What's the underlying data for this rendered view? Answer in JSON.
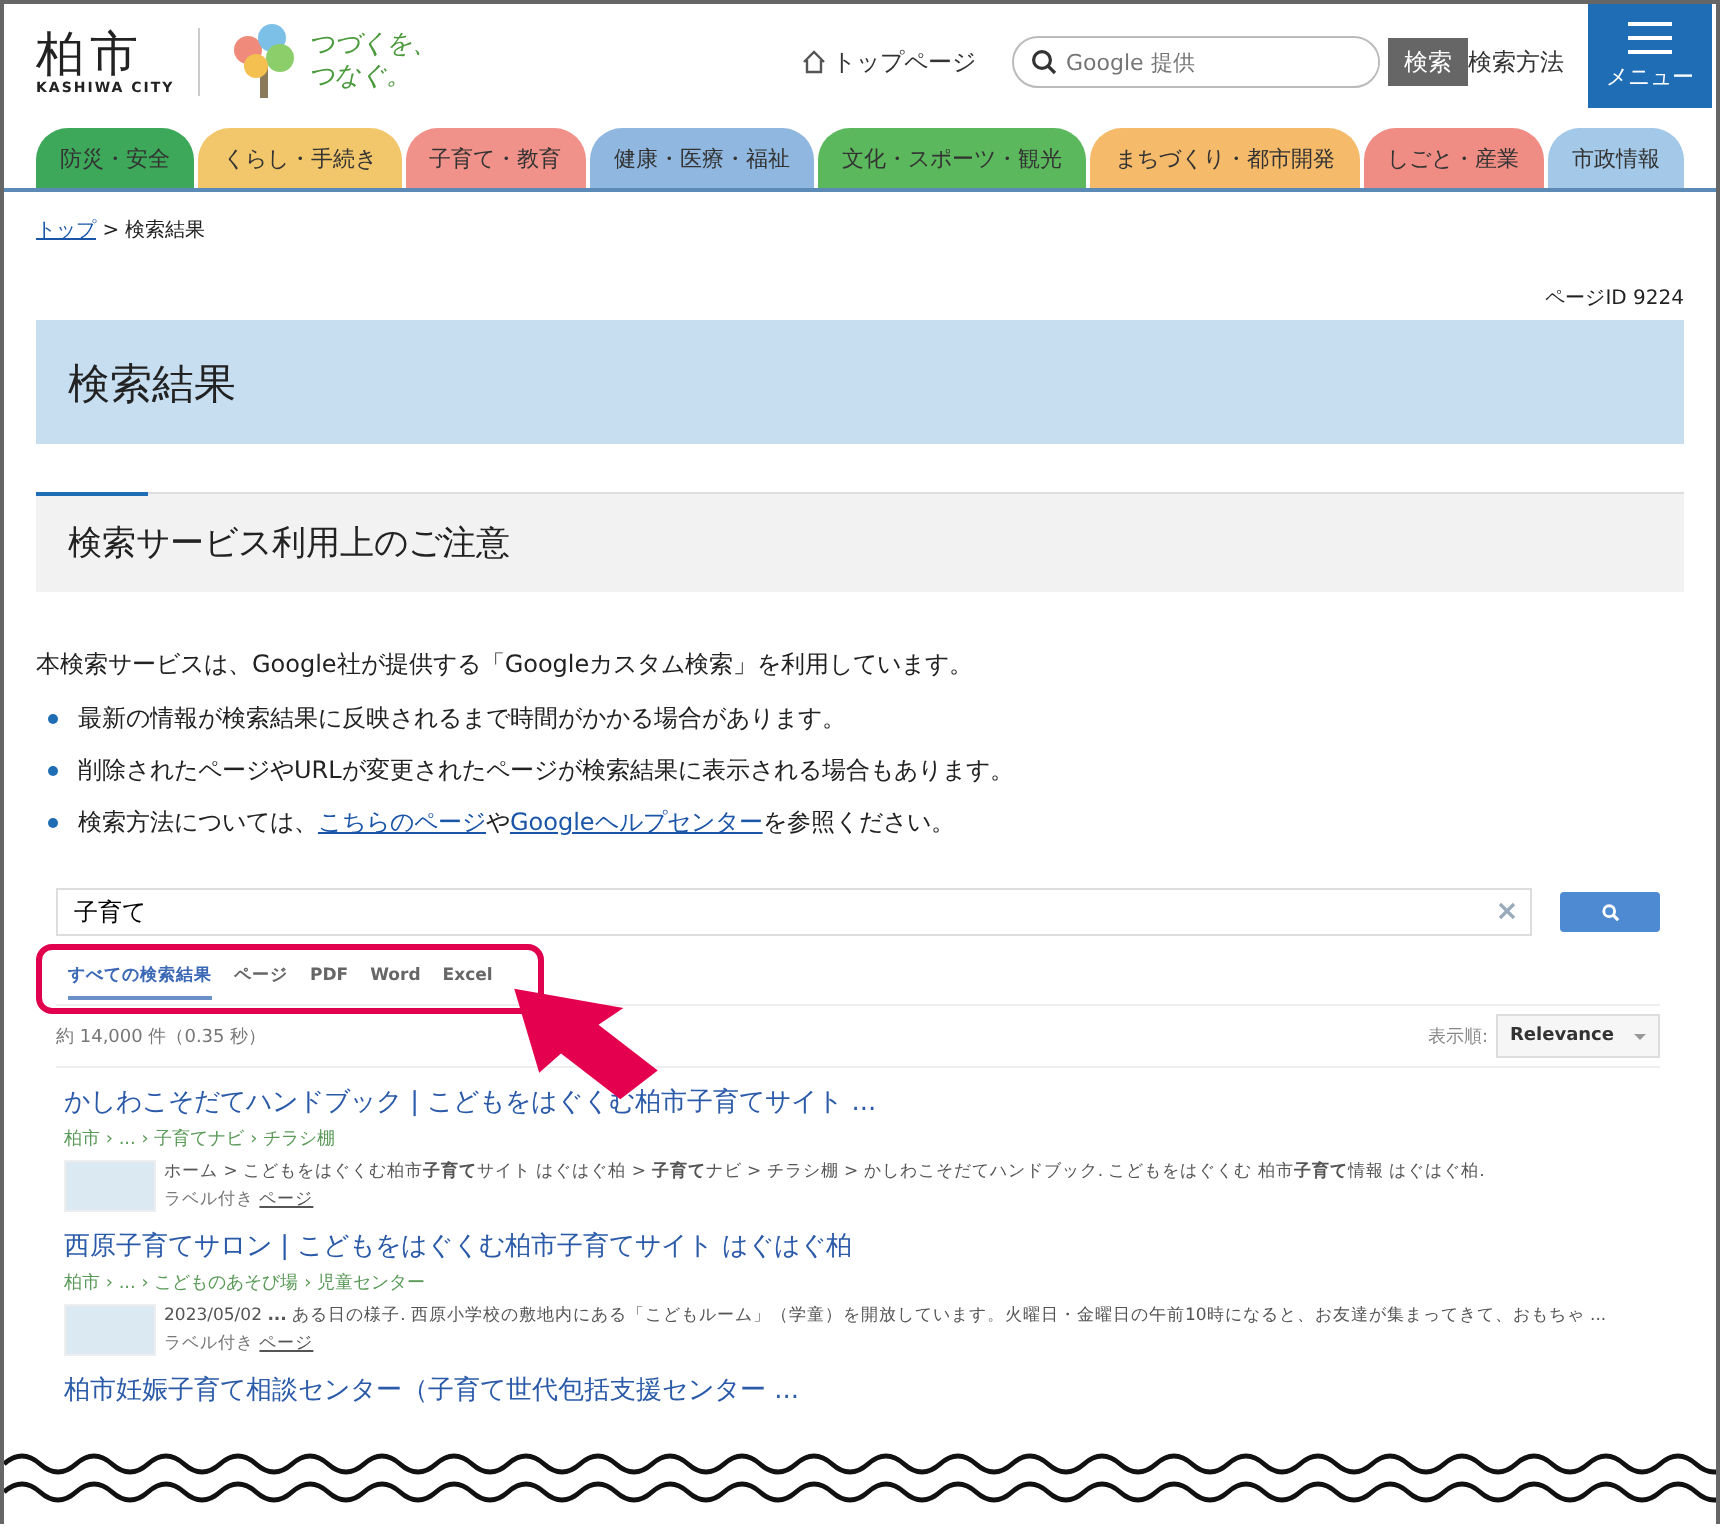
{
  "header": {
    "city_name": "柏市",
    "city_name_en": "KASHIWA CITY",
    "slogan": "つづくを、つなぐ。",
    "top_link": "トップページ",
    "search": {
      "placeholder": "Google 提供",
      "button": "検索"
    },
    "search_help": "検索方法",
    "menu": "メニュー"
  },
  "categories": [
    {
      "label": "防災・安全",
      "color": "#3da85a"
    },
    {
      "label": "くらし・手続き",
      "color": "#f2c66a"
    },
    {
      "label": "子育て・教育",
      "color": "#f0918a"
    },
    {
      "label": "健康・医療・福祉",
      "color": "#8fb7df"
    },
    {
      "label": "文化・スポーツ・観光",
      "color": "#5cb85c"
    },
    {
      "label": "まちづくり・都市開発",
      "color": "#f5bb6a"
    },
    {
      "label": "しごと・産業",
      "color": "#ef8d85"
    },
    {
      "label": "市政情報",
      "color": "#a3c8e8"
    }
  ],
  "breadcrumb": {
    "link": "トップ",
    "current": "> 検索結果"
  },
  "page_id": "ページID 9224",
  "title": "検索結果",
  "notice": {
    "heading": "検索サービス利用上のご注意",
    "intro": "本検索サービスは、Google社が提供する「Googleカスタム検索」を利用しています。",
    "bullets": [
      {
        "text": "最新の情報が検索結果に反映されるまで時間がかかる場合があります。"
      },
      {
        "text": "削除されたページやURLが変更されたページが検索結果に表示される場合もあります。"
      },
      {
        "before": "検索方法については、",
        "link1": "こちらのページ",
        "middle": "や",
        "link2": "Googleヘルプセンター",
        "after": "を参照ください。"
      }
    ]
  },
  "search": {
    "value": "子育て",
    "tabs": [
      {
        "label": "すべての検索結果",
        "selected": true
      },
      {
        "label": "ページ",
        "selected": false
      },
      {
        "label": "PDF",
        "selected": false
      },
      {
        "label": "Word",
        "selected": false
      },
      {
        "label": "Excel",
        "selected": false
      }
    ],
    "count": "約 14,000 件（0.35 秒）",
    "sort_label": "表示順:",
    "sort_value": "Relevance",
    "results": [
      {
        "title": "かしわこそだてハンドブック | こどもをはぐくむ柏市子育てサイト ...",
        "path": "柏市 › ... › 子育てナビ › チラシ棚",
        "snippet": "ホーム > こどもをはぐくむ柏市**子育て**サイト はぐはぐ柏 > **子育て**ナビ > チラシ棚 > かしわこそだてハンドブック. こどもをはぐくむ 柏市**子育て**情報 はぐはぐ柏.",
        "label": "ラベル付き",
        "label_link": "ページ"
      },
      {
        "title": "西原子育てサロン | こどもをはぐくむ柏市子育てサイト はぐはぐ柏",
        "path": "柏市 › ... › こどものあそび場 › 児童センター",
        "snippet": "2023/05/02 **...** ある日の様子. 西原小学校の敷地内にある「こどもルーム」（学童）を開放しています。火曜日・金曜日の午前10時になると、お友達が集まってきて、おもちゃ ...",
        "label": "ラベル付き",
        "label_link": "ページ"
      },
      {
        "title": "柏市妊娠子育て相談センター（子育て世代包括支援センター ..."
      }
    ]
  }
}
